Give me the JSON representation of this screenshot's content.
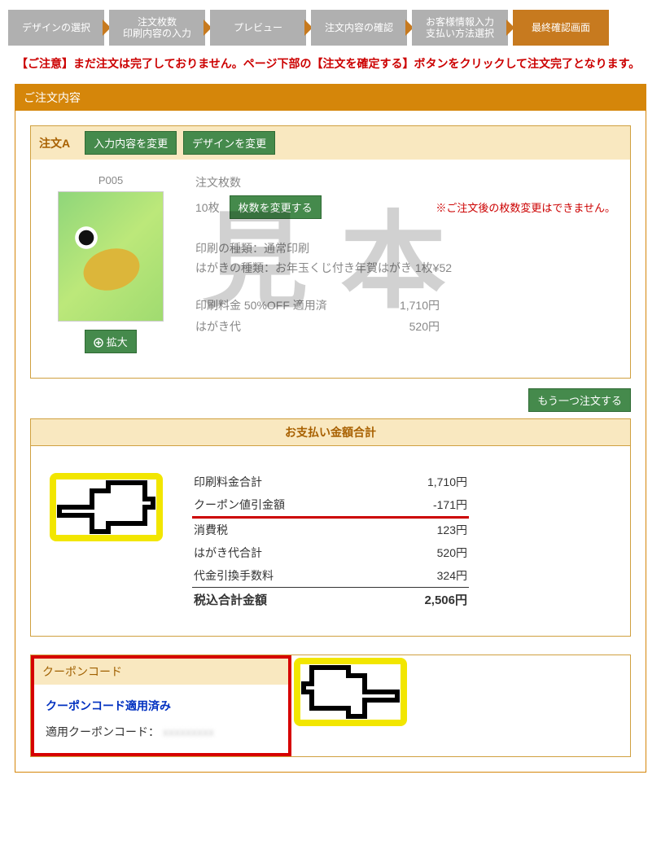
{
  "crumbs": [
    "デザインの選択",
    "注文枚数\n印刷内容の入力",
    "プレビュー",
    "注文内容の確認",
    "お客様情報入力\n支払い方法選択",
    "最終確認画面"
  ],
  "active_crumb": 5,
  "warning": "【ご注意】まだ注文は完了しておりません。ページ下部の【注文を確定する】ボタンをクリックして注文完了となります。",
  "frame_title": "ご注文内容",
  "order": {
    "title": "注文A",
    "btn_change_content": "入力内容を変更",
    "btn_change_design": "デザインを変更",
    "design_id": "P005",
    "btn_enlarge": "拡大",
    "qty_label": "注文枚数",
    "qty_value": "10枚",
    "btn_change_qty": "枚数を変更する",
    "qty_warn": "※ご注文後の枚数変更はできません。",
    "print_type": "印刷の種類：通常印刷",
    "hagaki_type": "はがきの種類：お年玉くじ付き年賀はがき 1枚¥52",
    "price1_label": "印刷料金 50%OFF 適用済",
    "price1_value": "1,710円",
    "price2_label": "はがき代",
    "price2_value": "520円",
    "watermark": "見本"
  },
  "btn_add_order": "もう一つ注文する",
  "sum_title": "お支払い金額合計",
  "sum_rows": [
    {
      "label": "印刷料金合計",
      "value": "1,710円"
    },
    {
      "label": "クーポン値引金額",
      "value": "-171円",
      "hl": true
    },
    {
      "label": "消費税",
      "value": "123円"
    },
    {
      "label": "はがき代合計",
      "value": "520円"
    },
    {
      "label": "代金引換手数料",
      "value": "324円",
      "sep": true
    },
    {
      "label": "税込合計金額",
      "value": "2,506円",
      "total": true
    }
  ],
  "coupon": {
    "title": "クーポンコード",
    "applied": "クーポンコード適用済み",
    "code_label": "適用クーポンコード：",
    "code_value": "xxxxxxxxx"
  }
}
